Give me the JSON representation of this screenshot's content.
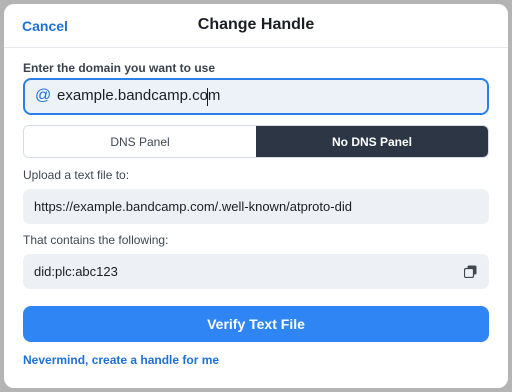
{
  "header": {
    "cancel_label": "Cancel",
    "title": "Change Handle"
  },
  "domain": {
    "label": "Enter the domain you want to use",
    "at_symbol": "@",
    "value": "example.bandcamp.com"
  },
  "tabs": [
    {
      "label": "DNS Panel",
      "selected": false
    },
    {
      "label": "No DNS Panel",
      "selected": true
    }
  ],
  "upload": {
    "label": "Upload a text file to:",
    "url": "https://example.bandcamp.com/.well-known/atproto-did"
  },
  "contents": {
    "label": "That contains the following:",
    "value": "did:plc:abc123",
    "copy_icon": "copy-icon"
  },
  "actions": {
    "verify_label": "Verify Text File",
    "nevermind_label": "Nevermind, create a handle for me"
  },
  "colors": {
    "accent": "#2e85f3",
    "link": "#1f70d6",
    "active_tab": "#2c3644"
  }
}
